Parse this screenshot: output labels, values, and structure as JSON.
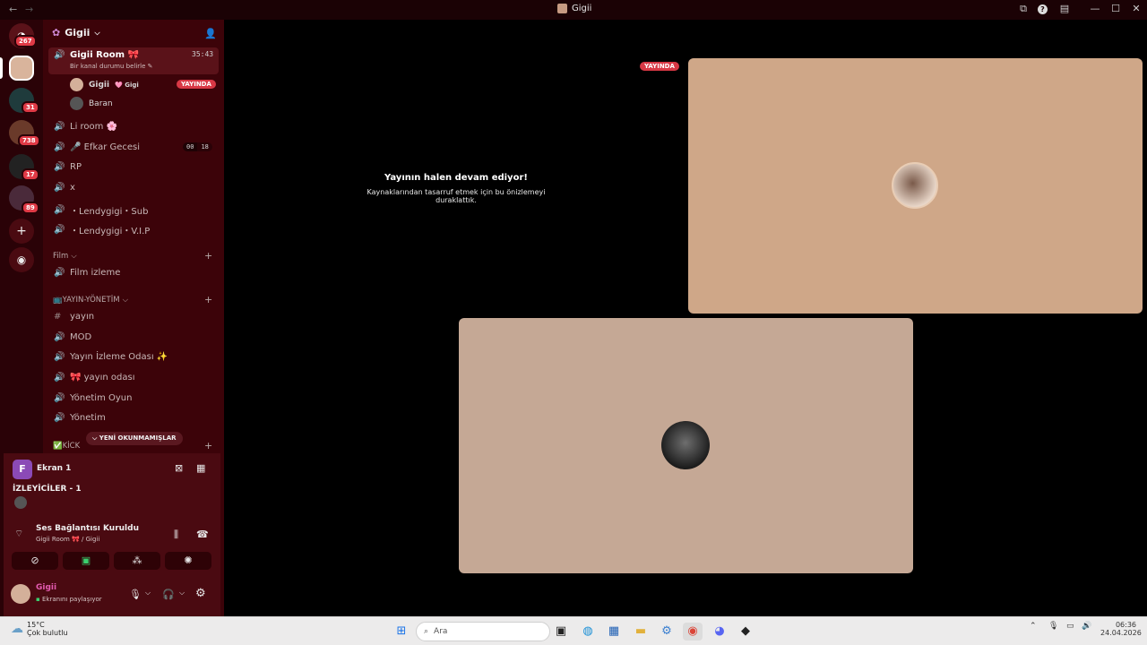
{
  "window": {
    "title": "Gigii",
    "back": "←",
    "forward": "→"
  },
  "rail": {
    "dm_badge": "267",
    "badges": [
      "31",
      "738",
      "17",
      "89"
    ]
  },
  "server": {
    "name": "Gigii",
    "chevron": "⌵"
  },
  "active_channel": {
    "name": "Gigii Room 🎀",
    "status": "Bir kanal durumu belirle",
    "timer": "35:43"
  },
  "channel_users": [
    {
      "name": "Gigii",
      "tag": "🩷 Gigi",
      "badge": "YAYINDA"
    },
    {
      "name": "Baran",
      "tag": "",
      "badge": ""
    }
  ],
  "channels": [
    {
      "name": "Li room 🌸"
    },
    {
      "name": "🎤 Efkar Gecesi",
      "count_a": "00",
      "count_b": "18"
    },
    {
      "name": "RP"
    },
    {
      "name": "x"
    },
    {
      "name": "・Lendygigi・Sub"
    },
    {
      "name": "・Lendygigi・V.I.P"
    }
  ],
  "categories": {
    "film": "Film",
    "film_channels": [
      "Film izleme"
    ],
    "yayin": "📺YAYIN-YÖNETİM",
    "yayin_channels": [
      "yayın",
      "MOD",
      "Yayın İzleme Odası ✨",
      "🎀 yayın odası",
      "Yönetim Oyun",
      "Yönetim"
    ],
    "kick": "✅KİCK",
    "unread_label": "YENİ OKUNMAMIŞLAR"
  },
  "share_panel": {
    "letter": "F",
    "title": "Ekran 1",
    "viewers_label": "İZLEYİCİLER - 1"
  },
  "voice_panel": {
    "status": "Ses Bağlantısı Kuruldu",
    "location": "Gigii Room 🎀 / Gigii"
  },
  "user_panel": {
    "name": "Gigii",
    "status": "Ekranını paylaşıyor"
  },
  "stream": {
    "live_label": "YAYINDA",
    "paused_title": "Yayının halen devam ediyor!",
    "paused_text": "Kaynaklarından tasarruf etmek için bu önizlemeyi duraklattık.",
    "tile_color_1": "#cfa788",
    "tile_color_2": "#c5a895"
  },
  "taskbar": {
    "weather_temp": "15°C",
    "weather_text": "Çok bulutlu",
    "search_placeholder": "Ara",
    "time": "06:36",
    "date": "24.04.2026"
  }
}
